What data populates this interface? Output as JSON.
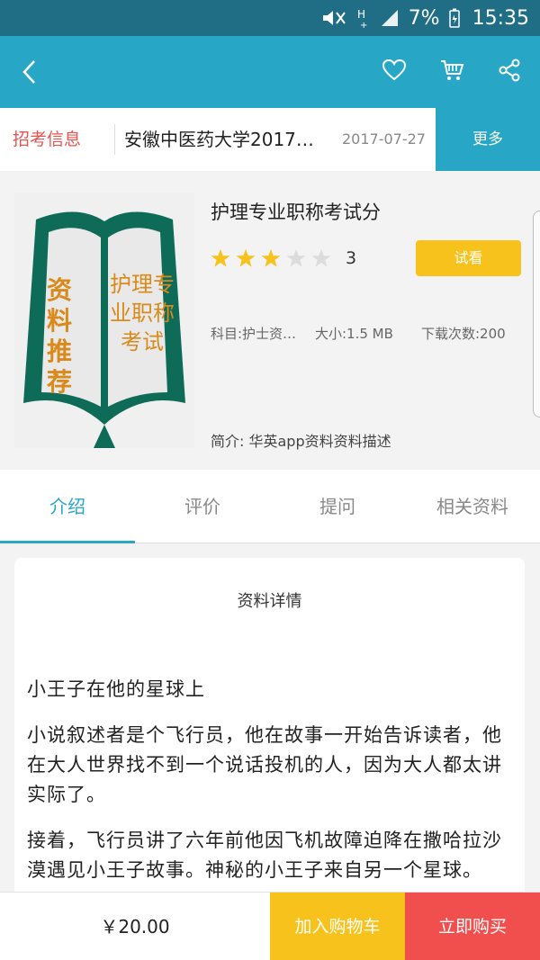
{
  "status_bar": {
    "battery": "7%",
    "time": "15:35"
  },
  "header": {
    "back_icon": "chevron-left-icon",
    "actions": [
      "heart-icon",
      "cart-icon",
      "share-icon"
    ]
  },
  "notice": {
    "tag": "招考信息",
    "title": "安徽中医药大学2017…",
    "date": "2017-07-27",
    "more": "更多"
  },
  "product": {
    "cover": {
      "left_text": "资料推荐",
      "right_text": "护理专业职称考试"
    },
    "title": "护理专业职称考试分",
    "rating": {
      "value": 3,
      "max": 5,
      "label": "3"
    },
    "try_button": "试看",
    "subject": "科目:护士资…",
    "size": "大小:1.5 MB",
    "downloads": "下载次数:200",
    "intro": "简介: 华英app资料资料描述"
  },
  "tabs": [
    {
      "label": "介绍",
      "active": true
    },
    {
      "label": "评价",
      "active": false
    },
    {
      "label": "提问",
      "active": false
    },
    {
      "label": "相关资料",
      "active": false
    }
  ],
  "detail": {
    "heading": "资料详情",
    "paragraphs": [
      "小王子在他的星球上",
      "小说叙述者是个飞行员，他在故事一开始告诉读者，他在大人世界找不到一个说话投机的人，因为大人都太讲实际了。",
      "接着，飞行员讲了六年前他因飞机故障迫降在撒哈拉沙漠遇见小王子故事。神秘的小王子来自另一个星球。"
    ]
  },
  "bottom_bar": {
    "price": "￥20.00",
    "add_to_cart": "加入购物车",
    "buy_now": "立即购买"
  },
  "colors": {
    "primary": "#27a6c6",
    "status_bar": "#1f6e86",
    "accent_yellow": "#f7c21b",
    "accent_red": "#f14e4e",
    "notice_red": "#e8534f",
    "cover_green": "#0e6b57",
    "cover_orange": "#d98a1a"
  }
}
